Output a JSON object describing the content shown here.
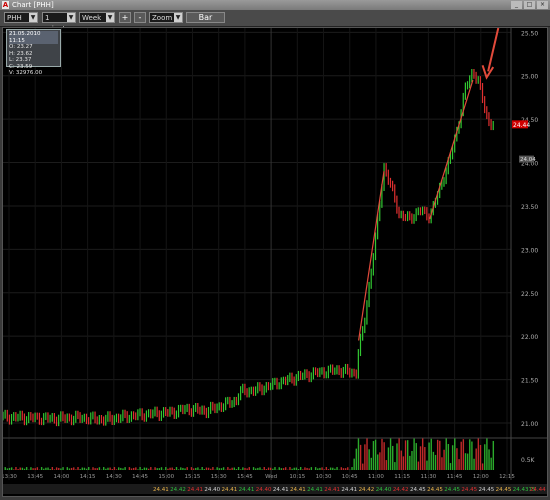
{
  "window": {
    "title": "Chart [PHH]",
    "logo_letter": "A",
    "controls": [
      "_",
      "□",
      "×"
    ]
  },
  "toolbar": {
    "symbol": "PHH",
    "interval": "1 minute",
    "range": "Week",
    "zoom_in_label": "+",
    "zoom_out_label": "-",
    "zoom_label": "Zoom",
    "chart_type_label": "Bar"
  },
  "info_box": {
    "header": "21.05.2010 11:15",
    "open": "O: 23.27",
    "high": "H: 23.62",
    "low": "L: 23.37",
    "close": "C: 23.59",
    "volume": "V: 32976.00"
  },
  "price_labels": {
    "current": "24.44",
    "gray": "24.04"
  },
  "tick_labels": {
    "volume": "0.5K"
  },
  "bottom_ticker": [
    "24.41",
    "24.42",
    "24.41",
    "24.40",
    "24.41",
    "24.41",
    "24.40",
    "24.41",
    "24.41",
    "24.41",
    "24.41",
    "24.41",
    "24.42",
    "24.40",
    "24.42",
    "24.45",
    "24.45",
    "24.45",
    "24.45",
    "24.45",
    "24.45",
    "24.4375",
    "24.44"
  ],
  "chart_data": {
    "type": "candlestick",
    "instrument": "PHH",
    "interval": "1 minute",
    "x_tick_labels": [
      "13:30",
      "13:45",
      "14:00",
      "14:15",
      "14:30",
      "14:45",
      "15:00",
      "15:15",
      "15:30",
      "15:45",
      "Wed",
      "10:15",
      "10:30",
      "10:45",
      "11:00",
      "11:15",
      "11:30",
      "11:45",
      "12:00",
      "12:15"
    ],
    "y_tick_labels": [
      "21.00",
      "21.50",
      "22.00",
      "22.50",
      "23.00",
      "23.50",
      "24.00",
      "24.50",
      "25.00",
      "25.50"
    ],
    "y_range": [
      20.85,
      25.55
    ],
    "current_price": 24.44,
    "price_series": [
      {
        "t": 0,
        "p": 21.07
      },
      {
        "t": 0.05,
        "p": 21.06
      },
      {
        "t": 0.1,
        "p": 21.05
      },
      {
        "t": 0.15,
        "p": 21.06
      },
      {
        "t": 0.2,
        "p": 21.04
      },
      {
        "t": 0.25,
        "p": 21.08
      },
      {
        "t": 0.3,
        "p": 21.11
      },
      {
        "t": 0.33,
        "p": 21.12
      },
      {
        "t": 0.36,
        "p": 21.16
      },
      {
        "t": 0.4,
        "p": 21.14
      },
      {
        "t": 0.43,
        "p": 21.2
      },
      {
        "t": 0.46,
        "p": 21.26
      },
      {
        "t": 0.465,
        "p": 21.36
      },
      {
        "t": 0.5,
        "p": 21.38
      },
      {
        "t": 0.54,
        "p": 21.46
      },
      {
        "t": 0.58,
        "p": 21.53
      },
      {
        "t": 0.62,
        "p": 21.58
      },
      {
        "t": 0.66,
        "p": 21.61
      },
      {
        "t": 0.695,
        "p": 21.57
      },
      {
        "t": 0.7,
        "p": 21.85
      },
      {
        "t": 0.71,
        "p": 22.1
      },
      {
        "t": 0.72,
        "p": 22.55
      },
      {
        "t": 0.735,
        "p": 23.2
      },
      {
        "t": 0.75,
        "p": 23.95
      },
      {
        "t": 0.765,
        "p": 23.7
      },
      {
        "t": 0.78,
        "p": 23.4
      },
      {
        "t": 0.8,
        "p": 23.35
      },
      {
        "t": 0.82,
        "p": 23.45
      },
      {
        "t": 0.84,
        "p": 23.38
      },
      {
        "t": 0.86,
        "p": 23.7
      },
      {
        "t": 0.88,
        "p": 24.05
      },
      {
        "t": 0.895,
        "p": 24.4
      },
      {
        "t": 0.91,
        "p": 24.85
      },
      {
        "t": 0.925,
        "p": 25.05
      },
      {
        "t": 0.935,
        "p": 24.95
      },
      {
        "t": 0.945,
        "p": 24.7
      },
      {
        "t": 0.955,
        "p": 24.47
      },
      {
        "t": 0.965,
        "p": 24.44
      }
    ],
    "annotation_color": "#e24a3b",
    "up_color": "#32c832",
    "down_color": "#e03030"
  }
}
